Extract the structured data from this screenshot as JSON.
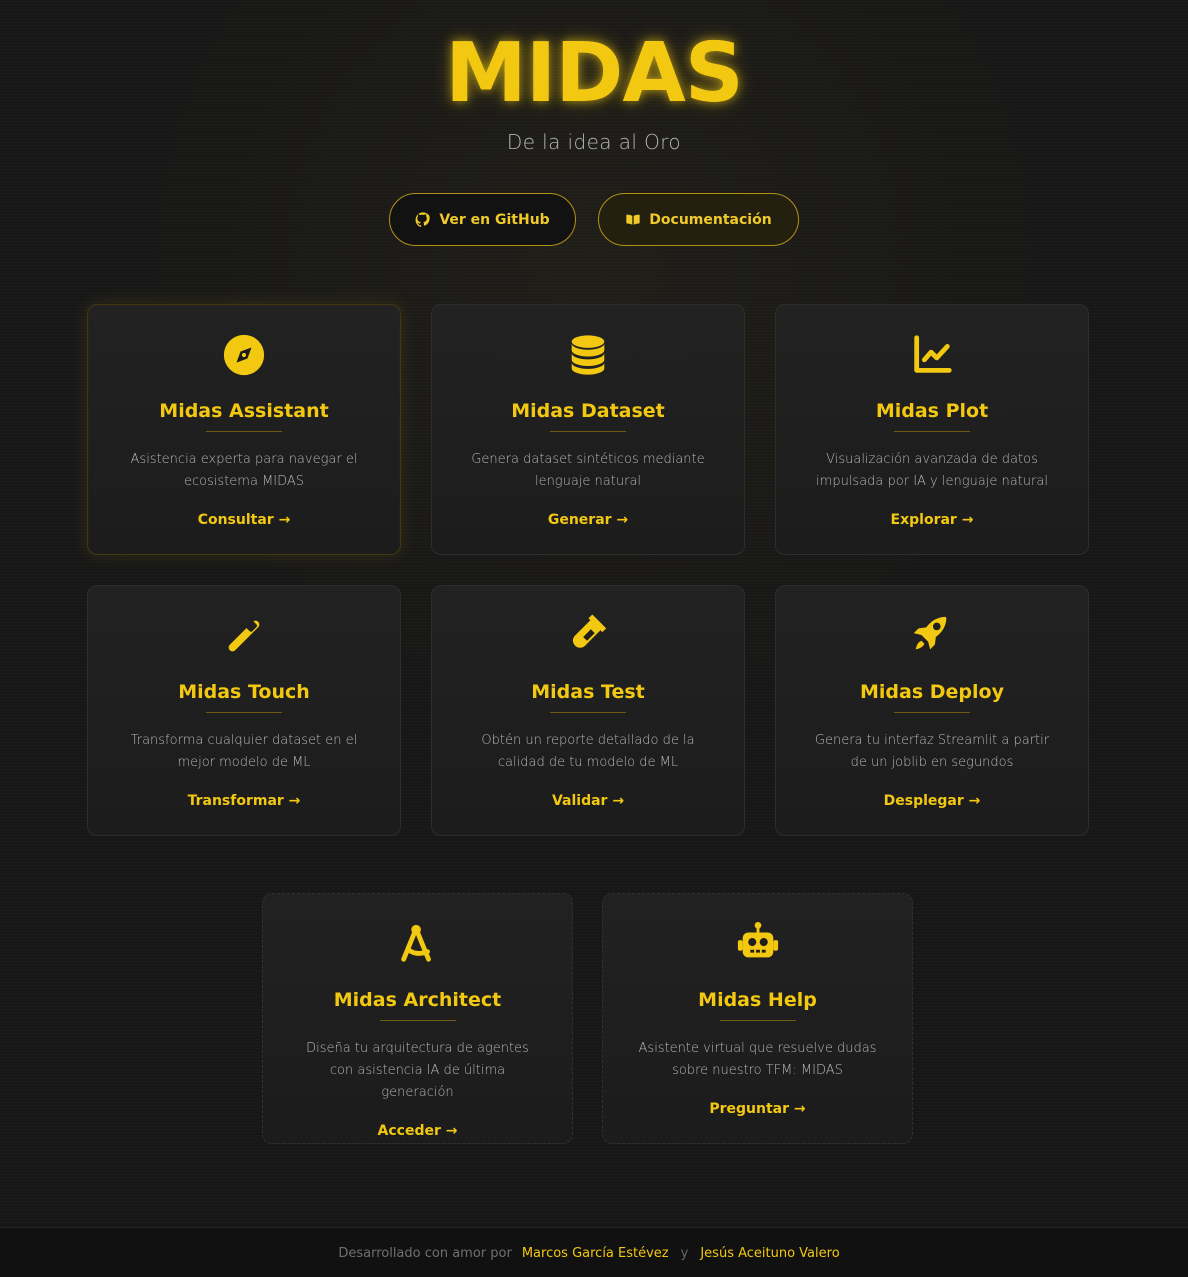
{
  "header": {
    "title": "MIDAS",
    "tagline": "De la idea al Oro"
  },
  "actions": {
    "github": {
      "label": "Ver en GitHub",
      "icon": "github-icon"
    },
    "docs": {
      "label": "Documentación",
      "icon": "book-open-icon"
    }
  },
  "cards": [
    {
      "title": "Midas Assistant",
      "description": "Asistencia experta para navegar el ecosistema MIDAS",
      "link": "Consultar →",
      "icon": "compass-icon"
    },
    {
      "title": "Midas Dataset",
      "description": "Genera dataset sintéticos mediante lenguaje natural",
      "link": "Generar →",
      "icon": "database-icon"
    },
    {
      "title": "Midas Plot",
      "description": "Visualización avanzada de datos impulsada por IA y lenguaje natural",
      "link": "Explorar →",
      "icon": "chart-line-icon"
    },
    {
      "title": "Midas Touch",
      "description": "Transforma cualquier dataset en el mejor modelo de ML",
      "link": "Transformar →",
      "icon": "wand-icon"
    },
    {
      "title": "Midas Test",
      "description": "Obtén un reporte detallado de la calidad de tu modelo de ML",
      "link": "Validar →",
      "icon": "test-tube-icon"
    },
    {
      "title": "Midas Deploy",
      "description": "Genera tu interfaz Streamlit a partir de un joblib en segundos",
      "link": "Desplegar →",
      "icon": "rocket-icon"
    },
    {
      "title": "Midas Architect",
      "description": "Diseña tu arquitectura de agentes con asistencia IA de última generación",
      "link": "Acceder →",
      "icon": "compass-drafting-icon"
    },
    {
      "title": "Midas Help",
      "description": "Asistente virtual que resuelve dudas sobre nuestro TFM: MIDAS",
      "link": "Preguntar →",
      "icon": "robot-icon"
    }
  ],
  "footer": {
    "prefix": "Desarrollado con amor por",
    "author_1": "Marcos García Estévez",
    "separator": "y",
    "author_2": "Jesús Aceituno Valero"
  },
  "colors": {
    "accent": "#f2c811",
    "background": "#171717",
    "card_background": "#202020",
    "text_muted": "#b6b6b6"
  }
}
